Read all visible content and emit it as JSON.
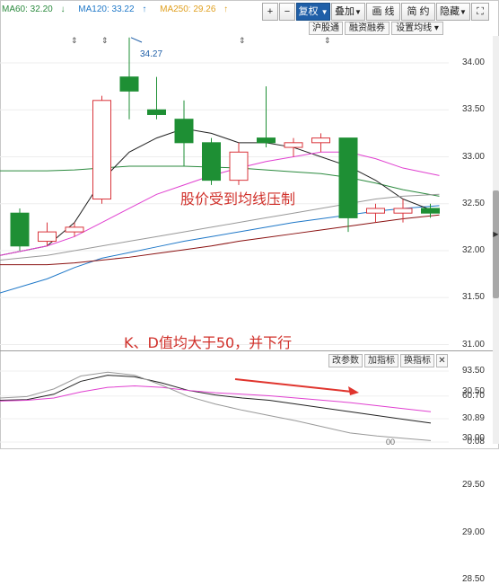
{
  "ma_legend": [
    {
      "label": "MA60: 32.20",
      "arrow": "↓",
      "color": "#2b8a3e"
    },
    {
      "label": "MA120: 33.22",
      "arrow": "↑",
      "color": "#1f78c8"
    },
    {
      "label": "MA250: 29.26",
      "arrow": "↑",
      "color": "#e0a020"
    }
  ],
  "toolbar": {
    "plus": "+",
    "minus": "−",
    "fuquan": "复权",
    "fuquan_arrow": "▼",
    "diejia": "叠加",
    "diejia_arrow": "▼",
    "huaxian": "画 线",
    "jianyue": "简 约",
    "yincang": "隐藏",
    "yincang_arrow": "▼",
    "fullscreen_icon": "⛶"
  },
  "subbar": {
    "hugutong": "沪股通",
    "rongzirongquan": "融资融券",
    "set_ma": "设置均线",
    "set_ma_arrow": "▾"
  },
  "price_axis": [
    "34.00",
    "33.50",
    "33.00",
    "32.50",
    "32.00",
    "31.50",
    "31.00",
    "30.50",
    "30.00",
    "29.50",
    "29.00",
    "28.50"
  ],
  "peak_label": "34.27",
  "annotation_main": "股价受到均线压制",
  "annotation_kd": "K、D值均大于50，并下行",
  "kdj_buttons": {
    "change_params": "改参数",
    "add_indicator": "加指标",
    "switch_indicator": "换指标",
    "close": "✕"
  },
  "kd_axis": [
    "93.50",
    "60.70",
    "30.89",
    "0.08"
  ],
  "kd_bottom_label": "00",
  "colors": {
    "up": "#d9343b",
    "down": "#1e8f34",
    "ma60": "#2b8a3e",
    "ma120": "#1f78c8",
    "ma250": "#e8a825",
    "pink": "#e040d0",
    "kd_arrow": "#e0352e"
  },
  "chart_data": [
    {
      "type": "candlestick",
      "title": "",
      "ylim": [
        28.25,
        34.5
      ],
      "candles": [
        {
          "o": 32.4,
          "c": 32.05,
          "h": 32.45,
          "l": 32.0
        },
        {
          "o": 32.1,
          "c": 32.2,
          "h": 32.3,
          "l": 32.05
        },
        {
          "o": 32.2,
          "c": 32.25,
          "h": 32.3,
          "l": 32.15
        },
        {
          "o": 32.55,
          "c": 33.6,
          "h": 33.65,
          "l": 32.5
        },
        {
          "o": 33.85,
          "c": 33.7,
          "h": 34.27,
          "l": 33.4
        },
        {
          "o": 33.5,
          "c": 33.45,
          "h": 33.85,
          "l": 33.4
        },
        {
          "o": 33.4,
          "c": 33.15,
          "h": 33.6,
          "l": 32.9
        },
        {
          "o": 33.15,
          "c": 32.75,
          "h": 33.2,
          "l": 32.7
        },
        {
          "o": 32.75,
          "c": 33.05,
          "h": 33.15,
          "l": 32.7
        },
        {
          "o": 33.2,
          "c": 33.15,
          "h": 33.75,
          "l": 33.1
        },
        {
          "o": 33.1,
          "c": 33.15,
          "h": 33.2,
          "l": 33.0
        },
        {
          "o": 33.15,
          "c": 33.2,
          "h": 33.25,
          "l": 33.05
        },
        {
          "o": 33.2,
          "c": 32.35,
          "h": 33.2,
          "l": 32.2
        },
        {
          "o": 32.4,
          "c": 32.45,
          "h": 32.5,
          "l": 32.3
        },
        {
          "o": 32.4,
          "c": 32.45,
          "h": 32.55,
          "l": 32.3
        },
        {
          "o": 32.45,
          "c": 32.4,
          "h": 32.5,
          "l": 32.35
        }
      ],
      "lines": [
        {
          "name": "MA60",
          "color": "#2b8a3e",
          "values": [
            32.85,
            32.85,
            32.86,
            32.88,
            32.9,
            32.9,
            32.9,
            32.89,
            32.88,
            32.86,
            32.84,
            32.82,
            32.78,
            32.72,
            32.65,
            32.58
          ]
        },
        {
          "name": "MA120",
          "color": "#1f78c8",
          "values": [
            31.55,
            31.7,
            31.82,
            31.92,
            31.98,
            32.04,
            32.1,
            32.15,
            32.2,
            32.25,
            32.3,
            32.34,
            32.38,
            32.42,
            32.45,
            32.48
          ]
        },
        {
          "name": "MA250",
          "color": "#e8a825",
          "values": [
            28.45,
            28.48,
            28.52,
            28.55,
            28.58,
            28.6,
            28.63,
            28.65,
            28.68,
            28.7,
            28.72,
            28.75,
            28.77,
            28.79,
            28.81,
            28.84
          ]
        },
        {
          "color": "#222222",
          "values": [
            31.95,
            32.05,
            32.3,
            32.75,
            33.05,
            33.2,
            33.3,
            33.25,
            33.15,
            33.15,
            33.1,
            33.0,
            32.9,
            32.75,
            32.55,
            32.4
          ]
        },
        {
          "color": "#e040d0",
          "values": [
            31.95,
            32.05,
            32.15,
            32.3,
            32.45,
            32.6,
            32.7,
            32.8,
            32.88,
            32.95,
            33.0,
            33.05,
            33.05,
            32.98,
            32.88,
            32.8
          ]
        },
        {
          "color": "#8a1010",
          "values": [
            31.85,
            31.85,
            31.87,
            31.9,
            31.93,
            31.97,
            32.01,
            32.05,
            32.1,
            32.14,
            32.18,
            32.22,
            32.26,
            32.3,
            32.34,
            32.38
          ]
        },
        {
          "color": "#999999",
          "values": [
            31.9,
            31.95,
            32.0,
            32.05,
            32.1,
            32.15,
            32.2,
            32.25,
            32.3,
            32.35,
            32.4,
            32.45,
            32.5,
            32.55,
            32.58,
            32.6
          ]
        }
      ]
    },
    {
      "type": "line",
      "title": "",
      "ylim": [
        0.08,
        93.5
      ],
      "series": [
        {
          "color": "#222222",
          "values": [
            55,
            56,
            63,
            80,
            88,
            86,
            78,
            68,
            62,
            58,
            55,
            50,
            45,
            40,
            35,
            30,
            25
          ]
        },
        {
          "color": "#e040d0",
          "values": [
            54,
            55,
            58,
            66,
            72,
            74,
            72,
            68,
            65,
            63,
            61,
            58,
            55,
            52,
            48,
            44,
            40
          ]
        },
        {
          "color": "#999999",
          "values": [
            58,
            60,
            70,
            87,
            92,
            88,
            75,
            60,
            50,
            42,
            35,
            28,
            20,
            12,
            8,
            5,
            2
          ]
        }
      ]
    }
  ]
}
